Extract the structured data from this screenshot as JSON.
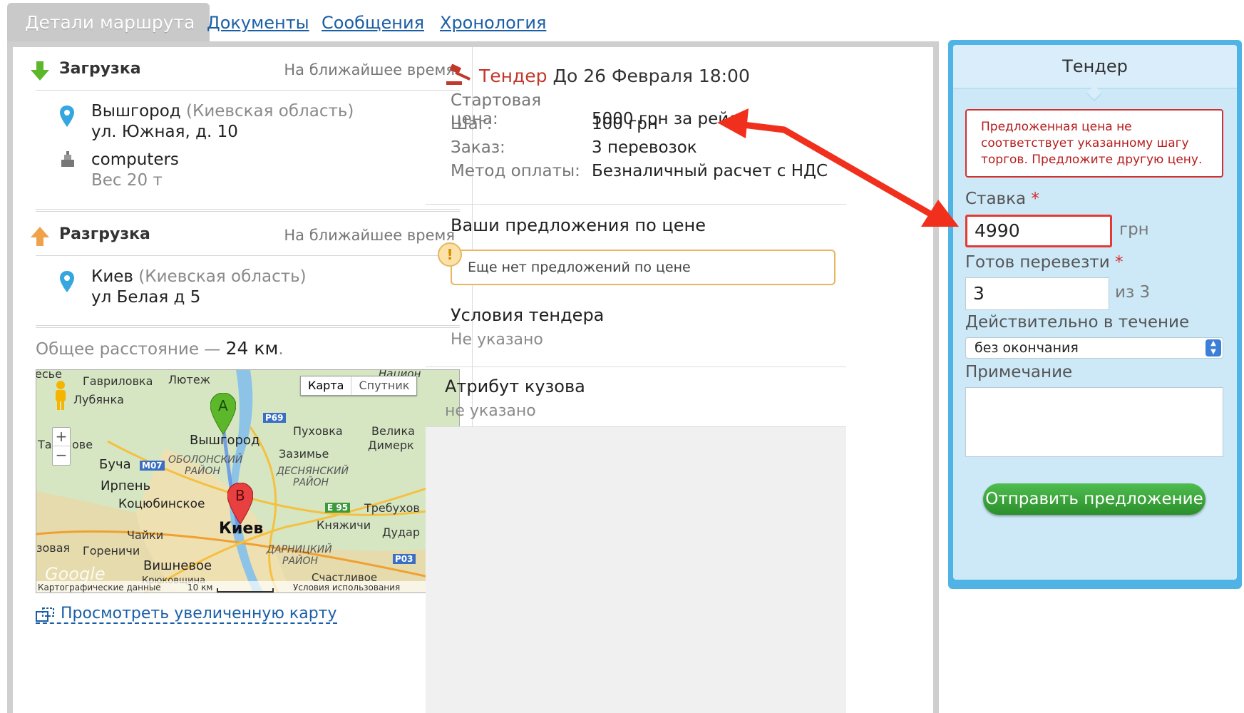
{
  "tabs": {
    "active": "Детали маршрута",
    "documents": "Документы",
    "messages": "Сообщения",
    "history": "Хронология"
  },
  "loading": {
    "label": "Загрузка",
    "when": "На ближайшее время",
    "city": "Вышгород",
    "region": "(Киевская область)",
    "address": "ул. Южная, д. 10",
    "cargo_name": "computers",
    "cargo_weight": "Вес 20 т"
  },
  "unloading": {
    "label": "Разгрузка",
    "when": "На ближайшее время",
    "city": "Киев",
    "region": "(Киевская область)",
    "address": "ул Белая д 5"
  },
  "distance": {
    "prefix": "Общее расстояние —",
    "value": "24 км",
    "suffix": "."
  },
  "map": {
    "type_map": "Карта",
    "type_satellite": "Спутник",
    "zoom_in": "+",
    "zoom_out": "−",
    "marker_a": "A",
    "marker_b": "B",
    "logo": "Google",
    "attribution": "Картографические данные",
    "scale": "10 км",
    "terms": "Условия использования",
    "labels": {
      "gavrilovka": "Гавриловка",
      "lyutezh": "Лютеж",
      "lubyanka": "Лубянка",
      "vyshgorod": "Вышгород",
      "pukhovka": "Пуховка",
      "velikaya": "Велика",
      "dymerka": "Димерк",
      "zazimye": "Зазимье",
      "bucha": "Буча",
      "irpen": "Ирпень",
      "obolon": "ОБОЛОНСКИЙ",
      "obolon2": "РАЙОН",
      "desna": "ДЕСНЯНСКИЙ",
      "desna2": "РАЙОН",
      "kotsyub": "Коцюбинское",
      "kiev": "Киев",
      "trebukhov": "Требухов",
      "knyazhichi": "Княжичи",
      "chaiki": "Чайки",
      "gorenichi": "Гореничи",
      "darnitsa": "ДАРНИЦКИЙ",
      "darnitsa2": "РАЙОН",
      "dudar": "Дудар",
      "vishnevoe": "Вишневое",
      "schastlivoe": "Счастливое",
      "krukovshina": "Крюковщина",
      "tarasovka": "Та",
      "tarasovka2": "ове",
      "zovaya": "зовая",
      "essye": "есье",
      "natsion": "Национ",
      "road_p69": "P69",
      "road_m07": "M07",
      "road_e95": "E 95",
      "road_p03": "P03"
    }
  },
  "map_link": "Просмотреть увеличенную карту",
  "tender": {
    "word": "Тендер",
    "deadline": "До 26 Февраля 18:00",
    "rows": [
      {
        "k": "Стартовая цена:",
        "v": "5000 грн за рейс"
      },
      {
        "k": "Шаг:",
        "v": "100 грн"
      },
      {
        "k": "Заказ:",
        "v": "3 перевозок"
      },
      {
        "k": "Метод оплаты:",
        "v": "Безналичный расчет с НДС"
      }
    ]
  },
  "offers": {
    "title": "Ваши предложения по цене",
    "empty": "Еще нет предложений по цене",
    "warn_icon": "!"
  },
  "conditions": {
    "title": "Условия тендера",
    "value": "Не указано"
  },
  "body_attr": {
    "title": "Атрибут кузова",
    "value": "не указано"
  },
  "panel": {
    "title": "Тендер",
    "error": "Предложенная цена не соответствует указанному шагу торгов. Предложите другую цену.",
    "bid_label": "Ставка",
    "bid_value": "4990",
    "bid_unit": "грн",
    "qty_label": "Готов перевезти",
    "qty_value": "3",
    "qty_of": "из 3",
    "valid_label": "Действительно в течение",
    "valid_value": "без окончания",
    "note_label": "Примечание",
    "note_value": "",
    "submit": "Отправить предложение",
    "required_mark": "*"
  },
  "colors": {
    "link": "#1a5fa6",
    "panel_border": "#4fb3e6",
    "error_red": "#d32f2f",
    "button_green": "#2b8f2b",
    "annotation_arrow": "#f0301c"
  }
}
